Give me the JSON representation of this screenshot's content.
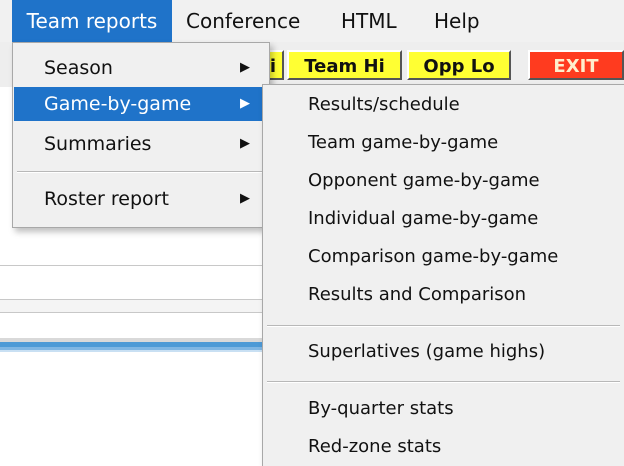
{
  "menubar": {
    "items": [
      "Team reports",
      "Conference",
      "HTML",
      "Help"
    ]
  },
  "toolbar": {
    "fragment_label": "i",
    "team_hi_label": "Team Hi",
    "opp_lo_label": "Opp Lo",
    "exit_label": "EXIT"
  },
  "team_reports_menu": {
    "items": [
      {
        "label": "Season",
        "submenu": true
      },
      {
        "label": "Game-by-game",
        "submenu": true,
        "highlighted": true
      },
      {
        "label": "Summaries",
        "submenu": true
      },
      {
        "label": "Roster report",
        "submenu": true
      }
    ],
    "arrow_glyph": "▶"
  },
  "game_by_game_submenu": {
    "items": [
      "Results/schedule",
      "Team game-by-game",
      "Opponent game-by-game",
      "Individual game-by-game",
      "Comparison game-by-game",
      "Results and Comparison",
      "Superlatives (game highs)",
      "By-quarter stats",
      "Red-zone stats"
    ]
  },
  "colors": {
    "highlight": "#1f73c9",
    "button_yellow": "#ffff33",
    "button_exit": "#ff3b1f"
  }
}
